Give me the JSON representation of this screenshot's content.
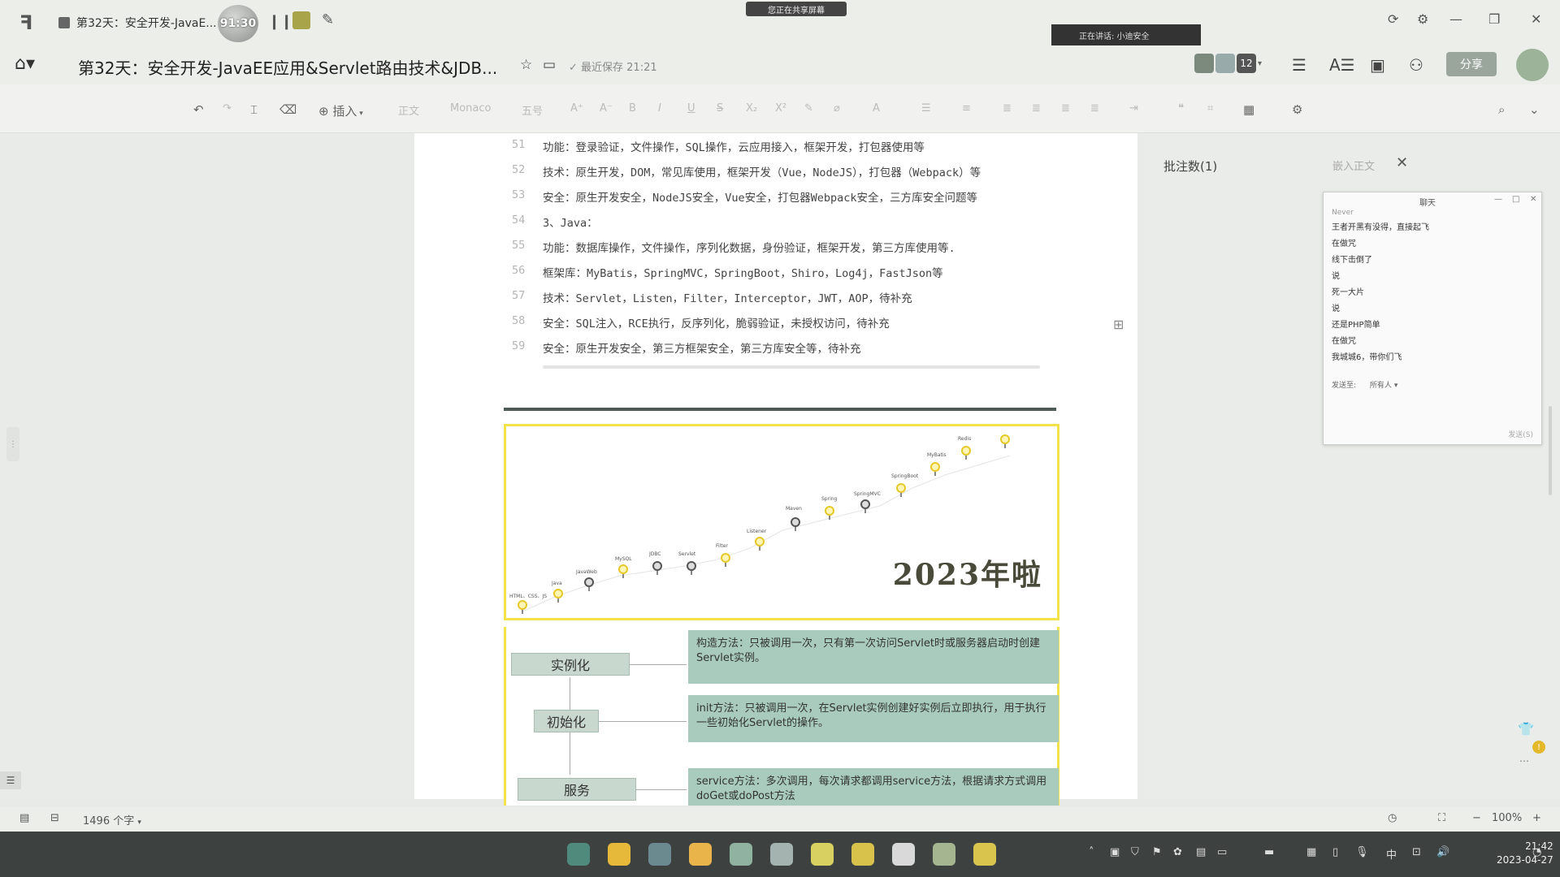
{
  "window": {
    "tab_title": "第32天：安全开发-JavaE...",
    "timer": "91:30",
    "share_banner": "您正在共享屏幕",
    "speaking": "正在讲话: 小迪安全"
  },
  "header": {
    "title": "第32天：安全开发-JavaEE应用&Servlet路由技术&JDB...",
    "saved": "最近保存 21:21",
    "collab_count": "12",
    "share_label": "分享"
  },
  "toolbar": {
    "insert": "插入",
    "style": "正文",
    "font": "Monaco",
    "size": "五号"
  },
  "code_lines": [
    {
      "no": "51",
      "text": "功能：登录验证，文件操作，SQL操作，云应用接入，框架开发，打包器使用等"
    },
    {
      "no": "52",
      "text": "技术：原生开发，DOM，常见库使用，框架开发（Vue，NodeJS），打包器（Webpack）等"
    },
    {
      "no": "53",
      "text": "安全：原生开发安全，NodeJS安全，Vue安全，打包器Webpack安全，三方库安全问题等"
    },
    {
      "no": "54",
      "text": "3、Java："
    },
    {
      "no": "55",
      "text": "功能：数据库操作，文件操作，序列化数据，身份验证，框架开发，第三方库使用等."
    },
    {
      "no": "56",
      "text": "框架库：MyBatis，SpringMVC，SpringBoot，Shiro，Log4j，FastJson等"
    },
    {
      "no": "57",
      "text": "技术：Servlet，Listen，Filter，Interceptor，JWT，AOP，待补充"
    },
    {
      "no": "58",
      "text": "安全：SQL注入，RCE执行，反序列化，脆弱验证，未授权访问，待补充"
    },
    {
      "no": "59",
      "text": "安全：原生开发安全，第三方框架安全，第三方库安全等，待补充"
    }
  ],
  "roadmap": {
    "year_text": "2023年啦",
    "labels": [
      "HTML、CSS、JS",
      "Java",
      "JavaWeb",
      "MySQL",
      "JDBC",
      "Servlet",
      "Filter",
      "Listener",
      "Maven",
      "Spring",
      "SpringMVC",
      "SpringBoot",
      "MyBatis",
      "Redis"
    ]
  },
  "lifecycle": {
    "stages": [
      "实例化",
      "初始化",
      "服务"
    ],
    "descriptions": [
      "构造方法：只被调用一次，只有第一次访问Servlet时或服务器启动时创建Servlet实例。",
      "init方法：只被调用一次，在Servlet实例创建好实例后立即执行，用于执行一些初始化Servlet的操作。",
      "service方法：多次调用，每次请求都调用service方法，根据请求方式调用doGet或doPost方法"
    ]
  },
  "comments": {
    "title": "批注数(1)",
    "embed": "嵌入正文"
  },
  "chat": {
    "title": "聊天",
    "sender_top": "Never",
    "messages": [
      "王者开黑有没得，直接起飞",
      "在做咒",
      "线下击倒了",
      "说",
      "死一大片",
      "说",
      "还是PHP简单",
      "在做咒",
      "我城城6，带你们飞"
    ],
    "send_to_label": "发送至:",
    "send_to_value": "所有人",
    "send_button": "发送(S)"
  },
  "statusbar": {
    "word_count": "1496 个字",
    "zoom": "100%"
  },
  "clock": {
    "time": "21:42",
    "date": "2023-04-27"
  },
  "taskbar_apps": [
    {
      "name": "windows",
      "color": "#4f8a7c"
    },
    {
      "name": "files",
      "color": "#e6b93a"
    },
    {
      "name": "edge",
      "color": "#6b8a8f"
    },
    {
      "name": "chrome",
      "color": "#e9b44a"
    },
    {
      "name": "app5",
      "color": "#8fb3a0"
    },
    {
      "name": "app6",
      "color": "#a4b3b0"
    },
    {
      "name": "app7",
      "color": "#d8d060"
    },
    {
      "name": "app8",
      "color": "#d8c24b"
    },
    {
      "name": "p-app",
      "color": "#d9d9d9"
    },
    {
      "name": "app10",
      "color": "#a5b58f"
    },
    {
      "name": "app11",
      "color": "#d9c44e"
    }
  ]
}
